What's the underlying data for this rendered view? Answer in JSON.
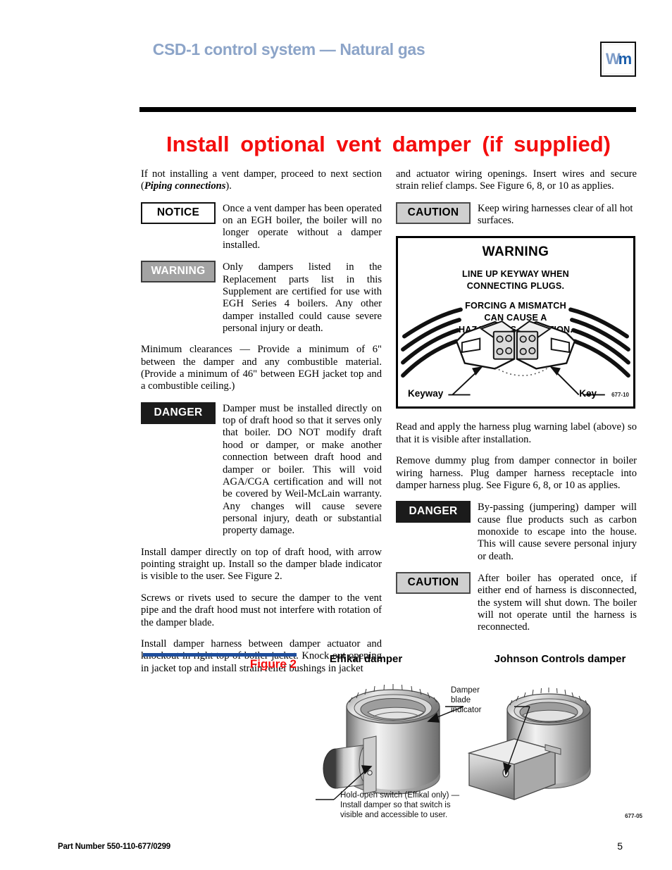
{
  "header": {
    "running_title": "CSD-1 control system — Natural gas",
    "logo_w": "W",
    "logo_m": "m",
    "logo_name": "Weil-McLain"
  },
  "title": "Install  optional  vent  damper  (if  supplied)",
  "left_column": {
    "intro_lead": "If not installing a vent damper, proceed to next section (",
    "intro_bold": "Piping connections",
    "intro_tail": ").",
    "alerts": [
      {
        "label": "NOTICE",
        "style": "notice",
        "text": "Once a vent damper has been operated on an EGH boiler, the boiler will no longer operate without a damper installed."
      },
      {
        "label": "WARNING",
        "style": "warning",
        "text": "Only dampers listed in the Replacement parts list in this Supplement are certified for use with EGH Series 4 boilers. Any other damper installed could cause severe personal injury or death."
      }
    ],
    "clearance_paragraph": "Minimum clearances — Provide a minimum of 6\" between the damper and any combustible material. (Provide a minimum of 46\" between EGH jacket top and a combustible ceiling.)",
    "danger": {
      "label": "DANGER",
      "style": "danger",
      "text": "Damper must be installed directly on top of draft hood so that it serves only that boiler. DO NOT modify draft hood or damper, or make another connection between draft hood and damper or boiler. This will void AGA/CGA certification and will not be covered by Weil-McLain warranty. Any changes will cause severe personal injury, death or substantial property damage."
    },
    "paragraphs": [
      "Install damper directly on top of draft hood, with arrow pointing straight up. Install so the damper blade indicator is visible to the user. See Figure 2.",
      "Screws or rivets used to secure the damper to the vent pipe and the draft hood must not interfere with rotation of the damper blade.",
      "Install damper harness between damper actuator and knockout in right top of boiler jacket. Knock out opening in jacket top and install strain relief bushings in jacket"
    ]
  },
  "right_column": {
    "continued_paragraph": "and actuator wiring openings. Insert wires and secure strain relief clamps. See Figure 6, 8, or 10 as applies.",
    "caution_top": {
      "label": "CAUTION",
      "style": "caution",
      "text": "Keep wiring harnesses clear of all hot surfaces."
    },
    "warning_figure": {
      "title": "WARNING",
      "line1": "LINE UP KEYWAY WHEN\nCONNECTING PLUGS.",
      "line2": "FORCING A MISMATCH\nCAN CAUSE A\nHAZARDOUS CONDITION.",
      "keyway_label": "Keyway",
      "key_label": "Key",
      "figure_code": "677-10"
    },
    "paragraphs": [
      "Read and apply the harness plug warning label (above) so that it is visible after installation.",
      "Remove dummy plug from damper connector in boiler wiring harness. Plug damper harness receptacle into damper harness plug. See Figure 6, 8, or 10 as applies."
    ],
    "danger": {
      "label": "DANGER",
      "style": "danger",
      "text": "By-passing (jumpering) damper will cause flue products such as carbon monoxide to escape into the house. This will cause severe personal injury or death."
    },
    "caution_bottom": {
      "label": "CAUTION",
      "style": "caution",
      "text": "After boiler has operated once, if either end of harness is disconnected, the system will shut down. The boiler will not operate until the harness is reconnected."
    }
  },
  "figure2": {
    "label": "Figure 2",
    "caption_left": "Effikal damper",
    "caption_right": "Johnson Controls damper",
    "callout_blade": "Damper\nblade\nindicator",
    "callout_switch": "Hold-open switch (Effikal only)  —\nInstall damper so that switch is\nvisible and accessible to user.",
    "figure_code": "677-05"
  },
  "footer": {
    "part_number": "Part Number 550-110-677/0299",
    "page_number": "5"
  }
}
